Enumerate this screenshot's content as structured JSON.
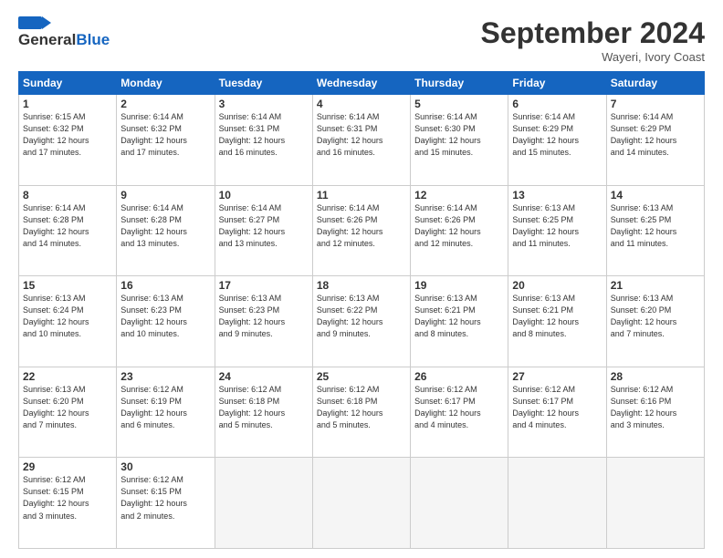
{
  "header": {
    "logo_line1": "General",
    "logo_line2": "Blue",
    "month_title": "September 2024",
    "location": "Wayeri, Ivory Coast"
  },
  "weekdays": [
    "Sunday",
    "Monday",
    "Tuesday",
    "Wednesday",
    "Thursday",
    "Friday",
    "Saturday"
  ],
  "weeks": [
    [
      {
        "day": "1",
        "info": "Sunrise: 6:15 AM\nSunset: 6:32 PM\nDaylight: 12 hours\nand 17 minutes."
      },
      {
        "day": "2",
        "info": "Sunrise: 6:14 AM\nSunset: 6:32 PM\nDaylight: 12 hours\nand 17 minutes."
      },
      {
        "day": "3",
        "info": "Sunrise: 6:14 AM\nSunset: 6:31 PM\nDaylight: 12 hours\nand 16 minutes."
      },
      {
        "day": "4",
        "info": "Sunrise: 6:14 AM\nSunset: 6:31 PM\nDaylight: 12 hours\nand 16 minutes."
      },
      {
        "day": "5",
        "info": "Sunrise: 6:14 AM\nSunset: 6:30 PM\nDaylight: 12 hours\nand 15 minutes."
      },
      {
        "day": "6",
        "info": "Sunrise: 6:14 AM\nSunset: 6:29 PM\nDaylight: 12 hours\nand 15 minutes."
      },
      {
        "day": "7",
        "info": "Sunrise: 6:14 AM\nSunset: 6:29 PM\nDaylight: 12 hours\nand 14 minutes."
      }
    ],
    [
      {
        "day": "8",
        "info": "Sunrise: 6:14 AM\nSunset: 6:28 PM\nDaylight: 12 hours\nand 14 minutes."
      },
      {
        "day": "9",
        "info": "Sunrise: 6:14 AM\nSunset: 6:28 PM\nDaylight: 12 hours\nand 13 minutes."
      },
      {
        "day": "10",
        "info": "Sunrise: 6:14 AM\nSunset: 6:27 PM\nDaylight: 12 hours\nand 13 minutes."
      },
      {
        "day": "11",
        "info": "Sunrise: 6:14 AM\nSunset: 6:26 PM\nDaylight: 12 hours\nand 12 minutes."
      },
      {
        "day": "12",
        "info": "Sunrise: 6:14 AM\nSunset: 6:26 PM\nDaylight: 12 hours\nand 12 minutes."
      },
      {
        "day": "13",
        "info": "Sunrise: 6:13 AM\nSunset: 6:25 PM\nDaylight: 12 hours\nand 11 minutes."
      },
      {
        "day": "14",
        "info": "Sunrise: 6:13 AM\nSunset: 6:25 PM\nDaylight: 12 hours\nand 11 minutes."
      }
    ],
    [
      {
        "day": "15",
        "info": "Sunrise: 6:13 AM\nSunset: 6:24 PM\nDaylight: 12 hours\nand 10 minutes."
      },
      {
        "day": "16",
        "info": "Sunrise: 6:13 AM\nSunset: 6:23 PM\nDaylight: 12 hours\nand 10 minutes."
      },
      {
        "day": "17",
        "info": "Sunrise: 6:13 AM\nSunset: 6:23 PM\nDaylight: 12 hours\nand 9 minutes."
      },
      {
        "day": "18",
        "info": "Sunrise: 6:13 AM\nSunset: 6:22 PM\nDaylight: 12 hours\nand 9 minutes."
      },
      {
        "day": "19",
        "info": "Sunrise: 6:13 AM\nSunset: 6:21 PM\nDaylight: 12 hours\nand 8 minutes."
      },
      {
        "day": "20",
        "info": "Sunrise: 6:13 AM\nSunset: 6:21 PM\nDaylight: 12 hours\nand 8 minutes."
      },
      {
        "day": "21",
        "info": "Sunrise: 6:13 AM\nSunset: 6:20 PM\nDaylight: 12 hours\nand 7 minutes."
      }
    ],
    [
      {
        "day": "22",
        "info": "Sunrise: 6:13 AM\nSunset: 6:20 PM\nDaylight: 12 hours\nand 7 minutes."
      },
      {
        "day": "23",
        "info": "Sunrise: 6:12 AM\nSunset: 6:19 PM\nDaylight: 12 hours\nand 6 minutes."
      },
      {
        "day": "24",
        "info": "Sunrise: 6:12 AM\nSunset: 6:18 PM\nDaylight: 12 hours\nand 5 minutes."
      },
      {
        "day": "25",
        "info": "Sunrise: 6:12 AM\nSunset: 6:18 PM\nDaylight: 12 hours\nand 5 minutes."
      },
      {
        "day": "26",
        "info": "Sunrise: 6:12 AM\nSunset: 6:17 PM\nDaylight: 12 hours\nand 4 minutes."
      },
      {
        "day": "27",
        "info": "Sunrise: 6:12 AM\nSunset: 6:17 PM\nDaylight: 12 hours\nand 4 minutes."
      },
      {
        "day": "28",
        "info": "Sunrise: 6:12 AM\nSunset: 6:16 PM\nDaylight: 12 hours\nand 3 minutes."
      }
    ],
    [
      {
        "day": "29",
        "info": "Sunrise: 6:12 AM\nSunset: 6:15 PM\nDaylight: 12 hours\nand 3 minutes."
      },
      {
        "day": "30",
        "info": "Sunrise: 6:12 AM\nSunset: 6:15 PM\nDaylight: 12 hours\nand 2 minutes."
      },
      {
        "day": "",
        "info": ""
      },
      {
        "day": "",
        "info": ""
      },
      {
        "day": "",
        "info": ""
      },
      {
        "day": "",
        "info": ""
      },
      {
        "day": "",
        "info": ""
      }
    ]
  ]
}
